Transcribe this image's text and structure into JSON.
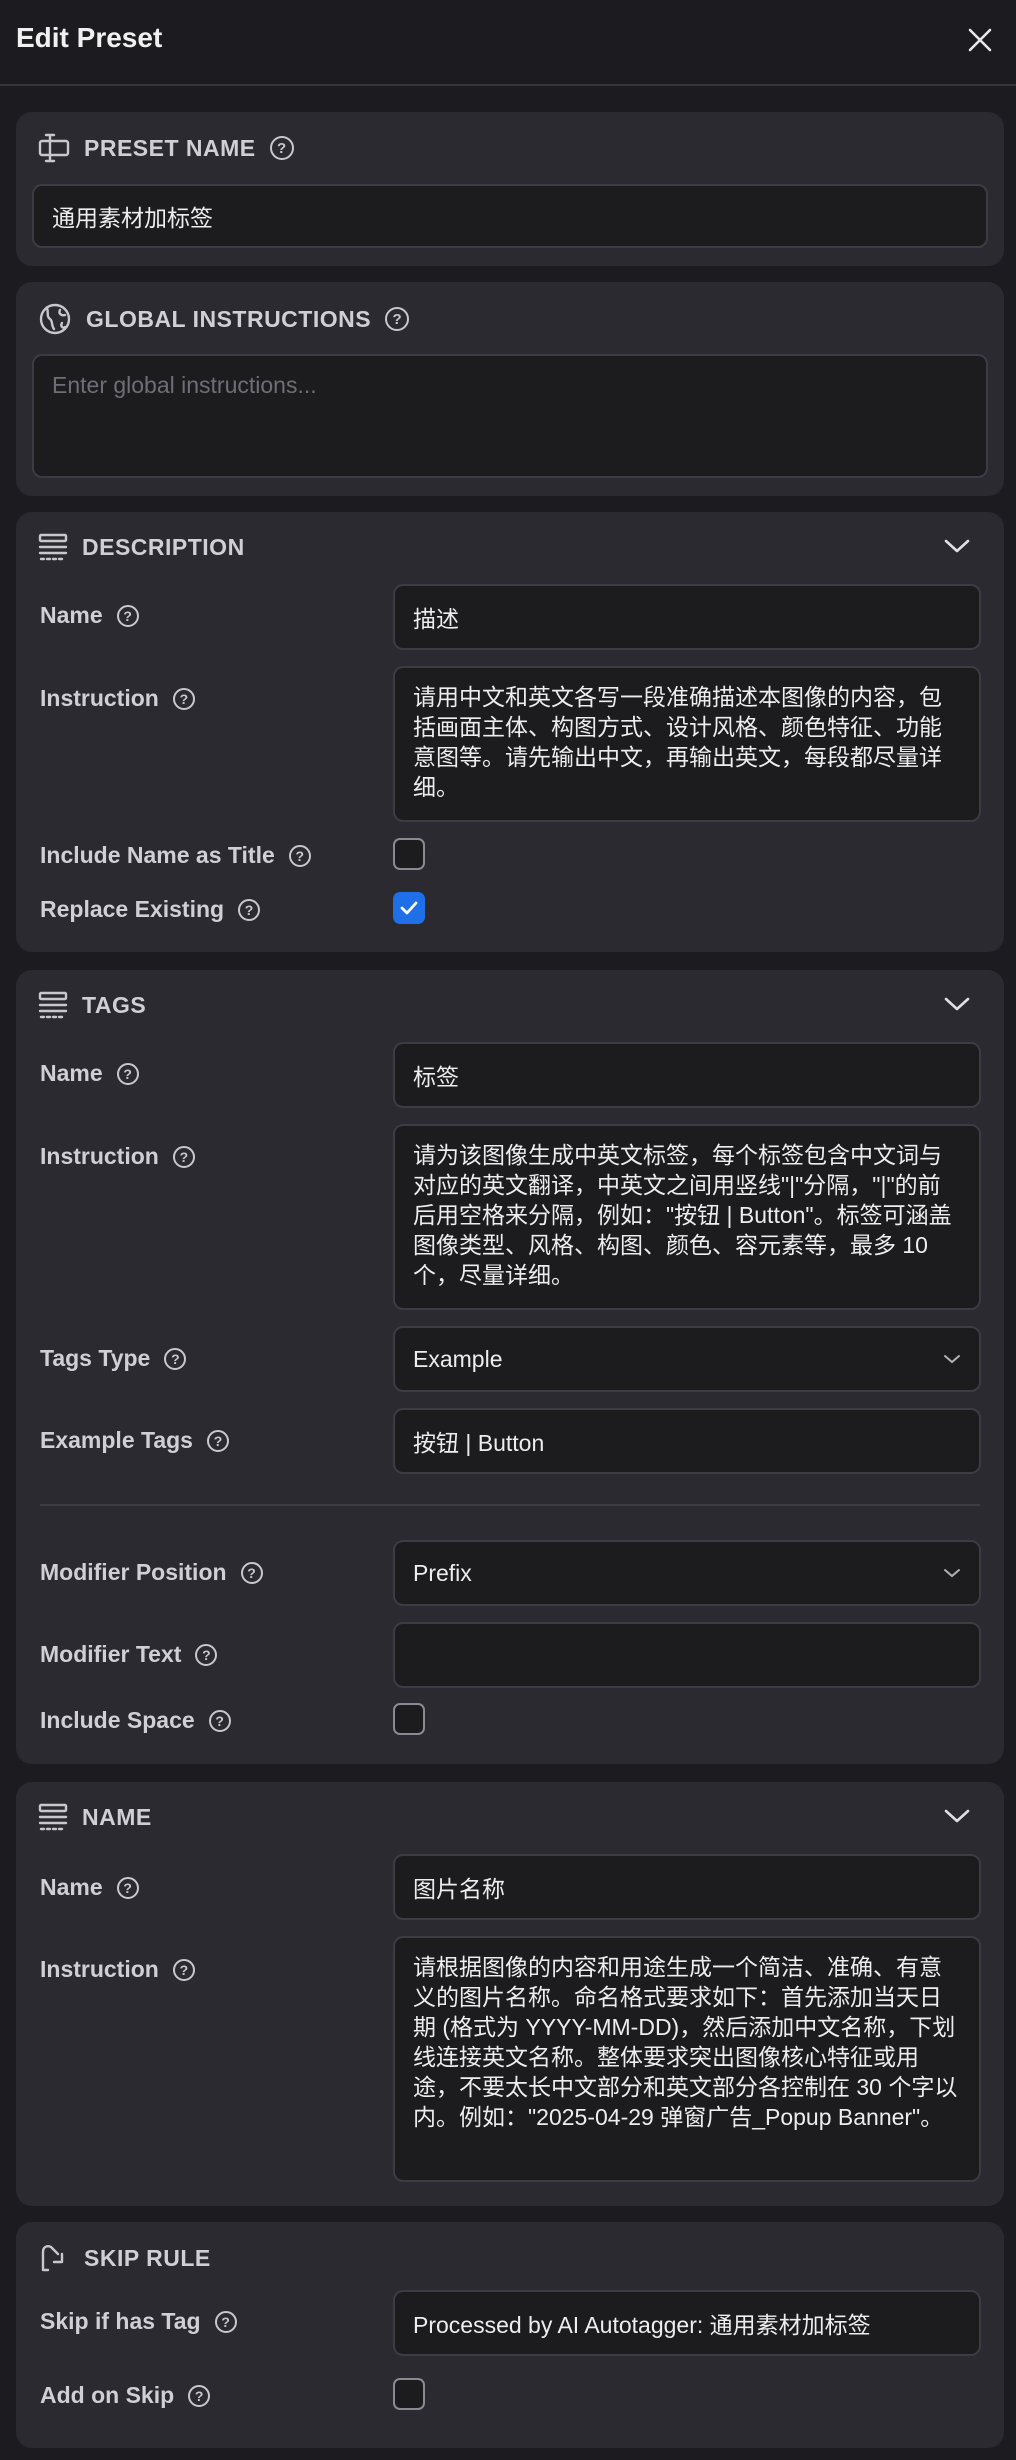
{
  "header": {
    "title": "Edit Preset"
  },
  "preset_name": {
    "title": "PRESET NAME",
    "value": "通用素材加标签"
  },
  "global_instructions": {
    "title": "GLOBAL INSTRUCTIONS",
    "placeholder": "Enter global instructions..."
  },
  "description": {
    "title": "DESCRIPTION",
    "name_label": "Name",
    "name_value": "描述",
    "instruction_label": "Instruction",
    "instruction_value": "请用中文和英文各写一段准确描述本图像的内容，包括画面主体、构图方式、设计风格、颜色特征、功能意图等。请先输出中文，再输出英文，每段都尽量详细。",
    "include_name_label": "Include Name as Title",
    "include_name_checked": false,
    "replace_label": "Replace Existing",
    "replace_checked": true
  },
  "tags": {
    "title": "TAGS",
    "name_label": "Name",
    "name_value": "标签",
    "instruction_label": "Instruction",
    "instruction_value": "请为该图像生成中英文标签，每个标签包含中文词与对应的英文翻译，中英文之间用竖线\"|\"分隔，\"|\"的前后用空格来分隔，例如：\"按钮 | Button\"。标签可涵盖图像类型、风格、构图、颜色、容元素等，最多 10 个，尽量详细。",
    "tags_type_label": "Tags Type",
    "tags_type_value": "Example",
    "example_tags_label": "Example Tags",
    "example_tags_value": "按钮 | Button",
    "modifier_position_label": "Modifier Position",
    "modifier_position_value": "Prefix",
    "modifier_text_label": "Modifier Text",
    "modifier_text_value": "",
    "include_space_label": "Include Space",
    "include_space_checked": false
  },
  "name_section": {
    "title": "NAME",
    "name_label": "Name",
    "name_value": "图片名称",
    "instruction_label": "Instruction",
    "instruction_value": "请根据图像的内容和用途生成一个简洁、准确、有意义的图片名称。命名格式要求如下：首先添加当天日期 (格式为 YYYY-MM-DD)，然后添加中文名称，下划线连接英文名称。整体要求突出图像核心特征或用途，不要太长中文部分和英文部分各控制在 30 个字以内。例如：\"2025-04-29 弹窗广告_Popup Banner\"。"
  },
  "skip_rule": {
    "title": "SKIP RULE",
    "skip_label": "Skip if has Tag",
    "skip_value": "Processed by AI Autotagger: 通用素材加标签",
    "add_label": "Add on Skip",
    "add_checked": false
  },
  "icons": {
    "close": "close-icon",
    "preset_name": "text-cursor-icon",
    "global": "globe-icon",
    "section": "stack-icon",
    "skip": "skip-arrow-icon",
    "help": "help-circle-icon",
    "chevron": "chevron-down-icon"
  },
  "colors": {
    "accent": "#1e6fe8",
    "background": "#1c1c20",
    "card": "#2a2a30"
  }
}
